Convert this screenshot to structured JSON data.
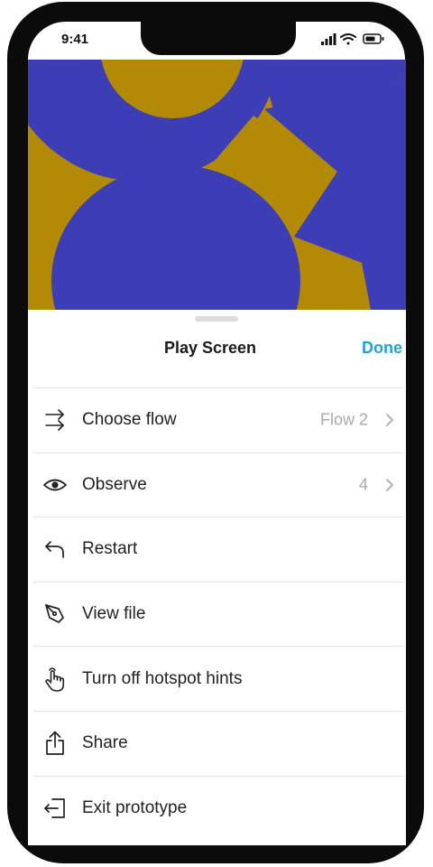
{
  "status_bar": {
    "time": "9:41",
    "icons": [
      "signal-icon",
      "wifi-icon",
      "battery-icon"
    ]
  },
  "sheet": {
    "title": "Play Screen",
    "done_label": "Done"
  },
  "menu": {
    "items": [
      {
        "icon": "flow-arrows-icon",
        "label": "Choose flow",
        "value": "Flow 2",
        "chevron": true
      },
      {
        "icon": "eye-icon",
        "label": "Observe",
        "value": "4",
        "chevron": true
      },
      {
        "icon": "restart-icon",
        "label": "Restart",
        "value": "",
        "chevron": false
      },
      {
        "icon": "pen-tool-icon",
        "label": "View file",
        "value": "",
        "chevron": false
      },
      {
        "icon": "hand-pointer-icon",
        "label": "Turn off hotspot hints",
        "value": "",
        "chevron": false
      },
      {
        "icon": "share-icon",
        "label": "Share",
        "value": "",
        "chevron": false
      },
      {
        "icon": "exit-icon",
        "label": "Exit prototype",
        "value": "",
        "chevron": false
      }
    ]
  },
  "colors": {
    "accent": "#1ea4d8",
    "artwork_blue": "#3d3db5",
    "artwork_gold": "#b38a06"
  }
}
